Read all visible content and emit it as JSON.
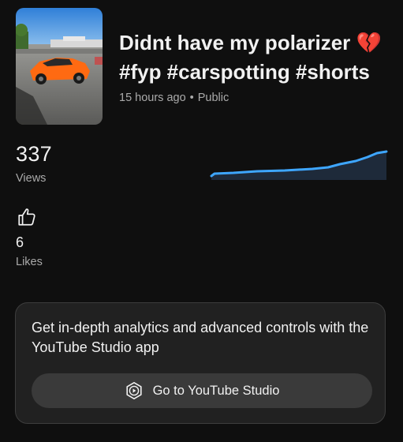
{
  "video": {
    "title": "Didnt have my polarizer 💔 #fyp #carspotting #shorts",
    "posted": "15 hours ago",
    "separator": "•",
    "visibility": "Public",
    "thumbnail_icon": "orange-supercar-thumbnail"
  },
  "stats": {
    "views": {
      "value": "337",
      "label": "Views",
      "chart_icon": "views-sparkline"
    },
    "likes": {
      "value": "6",
      "label": "Likes",
      "icon": "thumbs-up-icon"
    }
  },
  "promo": {
    "text": "Get in-depth analytics and advanced controls with the YouTube Studio app",
    "button_label": "Go to YouTube Studio",
    "button_icon": "youtube-studio-icon"
  },
  "colors": {
    "background": "#0f0f0f",
    "card_background": "#212121",
    "button_background": "#3a3a3a",
    "sparkline": "#3ea6ff",
    "secondary_text": "#aaaaaa"
  }
}
